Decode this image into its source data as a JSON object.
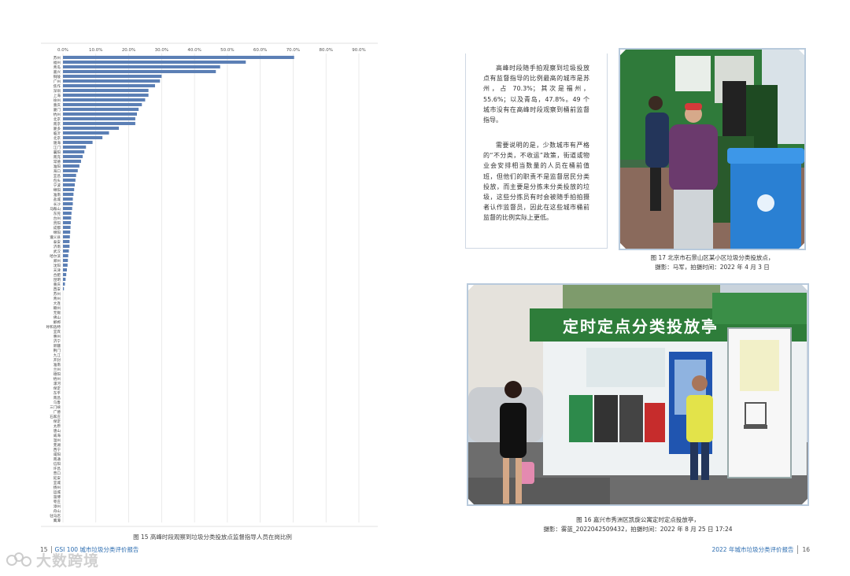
{
  "left_page": {
    "caption": "图 15 高峰时段观察到垃圾分类投放点监督指导人员在岗比例",
    "footer": {
      "page": "15",
      "title": "GSI 100 城市垃圾分类评价报告"
    }
  },
  "chart_data": {
    "type": "bar",
    "orientation": "horizontal",
    "xlim": [
      0,
      90
    ],
    "x_ticks": [
      "0.0%",
      "10.0%",
      "20.0%",
      "30.0%",
      "40.0%",
      "50.0%",
      "60.0%",
      "70.0%",
      "80.0%",
      "90.0%"
    ],
    "grid": true,
    "bar_color": "#5b7fb5",
    "categories": [
      "苏州",
      "福州",
      "青岛",
      "嘉兴",
      "铜陵",
      "广州",
      "焦作",
      "深圳",
      "上海",
      "徐州",
      "重庆",
      "厦门",
      "杭州",
      "北京",
      "南京",
      "厦多",
      "临沂",
      "北京",
      "陇海",
      "江门",
      "襄阳",
      "南充",
      "常德",
      "淮阳",
      "海口",
      "宜昌",
      "包头",
      "宁波",
      "绵阳",
      "淮南",
      "盐城",
      "长沙",
      "马鞍山",
      "东莞",
      "台州",
      "贵阳",
      "成都",
      "绵阳",
      "遵义县",
      "泰安",
      "济南",
      "武汉",
      "哈尔滨",
      "郑州",
      "沈阳",
      "天津",
      "合肥",
      "昆明",
      "重庆",
      "西安",
      "苏州",
      "青州",
      "大连",
      "赣州",
      "无锡",
      "佛山",
      "邯郸",
      "呼和浩特",
      "宜宾",
      "惠州",
      "济宁",
      "新疆",
      "荆门",
      "九江",
      "开封",
      "淮南",
      "兰州",
      "德阳",
      "梧州",
      "漯河",
      "保定",
      "东平",
      "南昌",
      "乌鲁",
      "三门峡",
      "广德",
      "石家庄",
      "保定",
      "太原",
      "唐山",
      "威海",
      "温州",
      "芜湖",
      "西宁",
      "咸阳",
      "南通",
      "信阳",
      "许昌",
      "营口",
      "延安",
      "宜城",
      "扬州",
      "运城",
      "淄博",
      "枣庄",
      "漳州",
      "舟山",
      "驻马店",
      "鹰潭"
    ],
    "values": [
      70.3,
      55.6,
      47.8,
      46.5,
      30.0,
      29.5,
      28.0,
      26.0,
      26.0,
      25.0,
      24.0,
      23.0,
      22.5,
      22.0,
      22.0,
      17.0,
      14.0,
      12.0,
      9.0,
      7.0,
      6.5,
      6.0,
      5.5,
      5.0,
      4.5,
      4.0,
      3.8,
      3.6,
      3.4,
      3.2,
      3.0,
      3.0,
      2.8,
      2.6,
      2.5,
      2.4,
      2.3,
      2.2,
      2.1,
      2.0,
      2.0,
      1.8,
      1.6,
      1.5,
      1.4,
      1.2,
      1.0,
      0.8,
      0.6,
      0.3,
      0,
      0,
      0,
      0,
      0,
      0,
      0,
      0,
      0,
      0,
      0,
      0,
      0,
      0,
      0,
      0,
      0,
      0,
      0,
      0,
      0,
      0,
      0,
      0,
      0,
      0,
      0,
      0,
      0,
      0,
      0,
      0,
      0,
      0,
      0,
      0,
      0,
      0,
      0,
      0,
      0,
      0,
      0,
      0,
      0,
      0,
      0,
      0,
      0,
      0
    ]
  },
  "right_page": {
    "paragraph_1": "高峰时段随手拍观察到垃圾投放点有监督指导的比例最高的城市是苏州，占 70.3%；其次是福州，55.6%；以及青岛，47.8%。49 个城市没有在高峰时段观察到桶前监督指导。",
    "paragraph_2": "需要说明的是，少数城市有严格的“不分类，不收运”政策，街道或物业会安排相当数量的人员在桶前值班，但他们的职责不是监督居民分类投放，而主要是分拣未分类投放的垃圾，这些分拣员有时会被随手拍拍摄者认作监督员，因此在这些城市桶前监督的比例实际上更低。",
    "photo_top_caption_1": "图 17 北京市石景山区某小区垃圾分类投放点，",
    "photo_top_caption_2": "摄影：马军，拍摄时间：2022 年 4 月 3 日",
    "photo_bottom_caption_1": "图 16 嘉兴市秀洲区凯旋公寓定时定点投放亭，",
    "photo_bottom_caption_2": "摄影：雾蓝_20220425094​32，拍摄时间：2022 年 8 月 25 日 17:24",
    "kiosk_sign": "定时定点分类投放亭",
    "footer": {
      "page": "16",
      "title": "2022 年城市垃圾分类评价报告"
    }
  },
  "watermark": "大数跨境"
}
